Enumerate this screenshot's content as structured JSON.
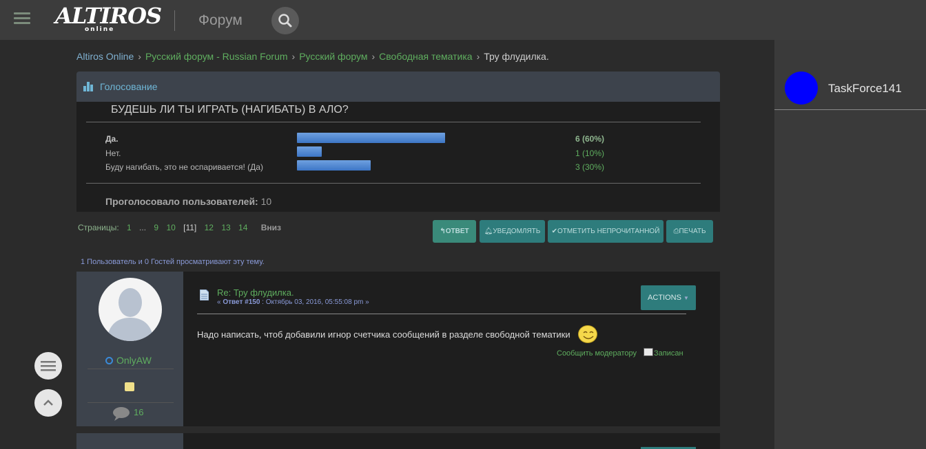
{
  "header": {
    "logo_main": "ALTIROS",
    "logo_sub": "online",
    "section_title": "Форум"
  },
  "user": {
    "name": "TaskForce141",
    "avatar_color": "#0000ff"
  },
  "breadcrumb": [
    "Altiros Online",
    "Русский форум - Russian Forum",
    "Русский форум",
    "Свободная тематика",
    "Тру флудилка."
  ],
  "poll": {
    "header": "Голосование",
    "question": "БУДЕШЬ ЛИ ТЫ ИГРАТЬ (НАГИБАТЬ) В АЛО?",
    "options": [
      {
        "label": "Да.",
        "result": "6 (60%)",
        "fraction": 0.6
      },
      {
        "label": "Нет.",
        "result": "1 (10%)",
        "fraction": 0.1
      },
      {
        "label": "Буду нагибать, это не оспаривается! (Да)",
        "result": "3 (30%)",
        "fraction": 0.3
      }
    ],
    "total_label": "Проголосовало пользователей:",
    "total_value": "10"
  },
  "pagination": {
    "label": "Страницы:",
    "p1": "1",
    "dots": "...",
    "p9": "9",
    "p10": "10",
    "current": "[11]",
    "p12": "12",
    "p13": "13",
    "p14": "14",
    "down": "Вниз"
  },
  "buttons": {
    "reply": "ОТВЕТ",
    "notify": "УВЕДОМЛЯТЬ",
    "mark_unread": "ОТМЕТИТЬ НЕПРОЧИТАННОЙ",
    "print": "ПЕЧАТЬ"
  },
  "viewers": "1 Пользователь и 0 Гостей просматривают эту тему.",
  "post": {
    "author": "OnlyAW",
    "message_count": "16",
    "subject": "Re: Тру флудилка.",
    "meta_prefix": "« ",
    "meta_reply": "Ответ #150",
    "meta_rest": " : Октябрь 03, 2016, 05:55:08 pm »",
    "actions": "ACTIONS",
    "text": "Надо написать, чтоб добавили игнор счетчика сообщений в разделе свободной тематики",
    "report": "Сообщить модератору",
    "logged": "Записан"
  },
  "colors": {
    "accent_green": "#5fae5f",
    "button_teal": "#2e7c7c",
    "poll_bar": "#3d76c6"
  }
}
